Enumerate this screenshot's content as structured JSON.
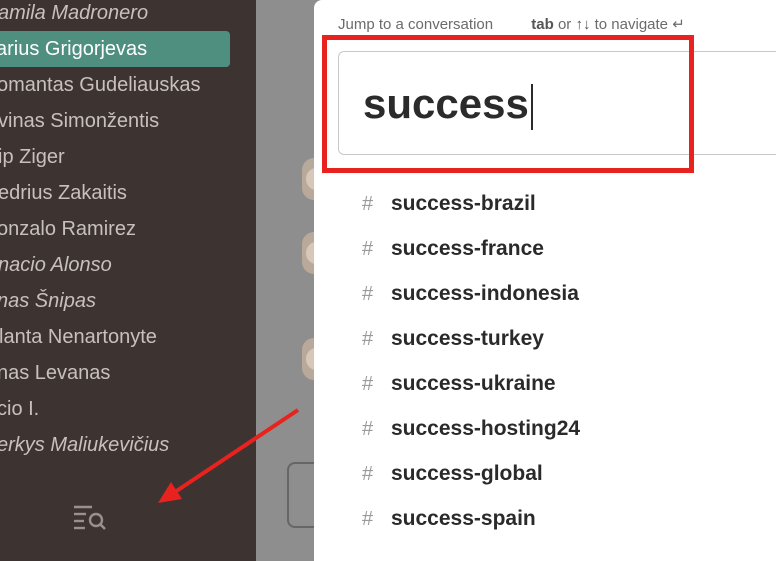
{
  "sidebar": {
    "items": [
      {
        "label": "amila Madronero",
        "italic": true,
        "active": false
      },
      {
        "label": "arius Grigorjevas",
        "italic": false,
        "active": true
      },
      {
        "label": "omantas Gudeliauskas",
        "italic": false,
        "active": false
      },
      {
        "label": "vinas Simonžentis",
        "italic": false,
        "active": false
      },
      {
        "label": "ip Ziger",
        "italic": false,
        "active": false
      },
      {
        "label": "edrius Zakaitis",
        "italic": false,
        "active": false
      },
      {
        "label": "onzalo Ramirez",
        "italic": false,
        "active": false
      },
      {
        "label": "nacio Alonso",
        "italic": true,
        "active": false
      },
      {
        "label": "nas Šnipas",
        "italic": true,
        "active": false
      },
      {
        "label": "lanta Nenartonyte",
        "italic": false,
        "active": false
      },
      {
        "label": "nas Levanas",
        "italic": false,
        "active": false
      },
      {
        "label": "cio I.",
        "italic": false,
        "active": false
      },
      {
        "label": "erkys Maliukevičius",
        "italic": true,
        "active": false
      }
    ],
    "search_icon": "search-list-icon"
  },
  "switcher": {
    "hint": "Jump to a conversation",
    "tab_key": "tab",
    "or_text": "or",
    "arrows": "↑↓",
    "navigate_text": "to navigate",
    "enter_glyph": "↵",
    "query": "success",
    "results": [
      {
        "prefix": "#",
        "name": "success-brazil"
      },
      {
        "prefix": "#",
        "name": "success-france"
      },
      {
        "prefix": "#",
        "name": "success-indonesia"
      },
      {
        "prefix": "#",
        "name": "success-turkey"
      },
      {
        "prefix": "#",
        "name": "success-ukraine"
      },
      {
        "prefix": "#",
        "name": "success-hosting24"
      },
      {
        "prefix": "#",
        "name": "success-global"
      },
      {
        "prefix": "#",
        "name": "success-spain"
      }
    ]
  },
  "colors": {
    "sidebar_bg": "#3d3431",
    "active_item": "#4e8f7f",
    "annotation_red": "#e8231f"
  }
}
